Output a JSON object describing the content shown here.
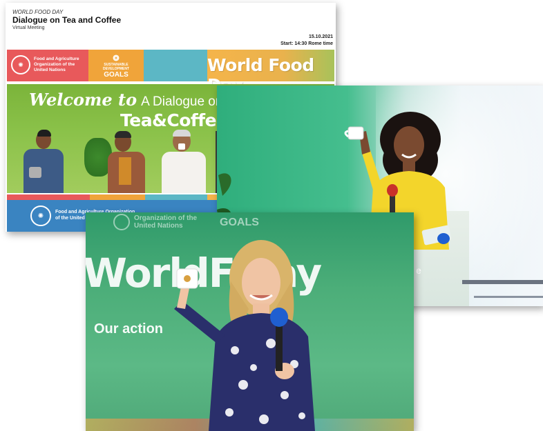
{
  "flyer": {
    "kicker": "WORLD FOOD DAY",
    "title": "Dialogue on Tea and Coffee",
    "subtitle": "Virtual Meeting",
    "date": "15.10.2021",
    "start": "Start: 14:30  Rome time",
    "fao_line1": "Food and Agriculture",
    "fao_line2": "Organization of the",
    "fao_line3": "United Nations",
    "sdg_small": "SUSTAINABLE DEVELOPMENT",
    "sdg_big": "GOALS",
    "banner_title": "World Food Day",
    "welcome_script": "Welcome to",
    "welcome_rest": "A Dialogue on",
    "tea_coffee": "Tea&Coffee",
    "footer_line1": "Food and Agriculture Organization",
    "footer_line2": "of the United"
  },
  "speaker2": {
    "podium_text": "e"
  },
  "speaker1": {
    "logo_line1": "Organization of the",
    "logo_line2": "United Nations",
    "goals": "GOALS",
    "wfd_big": "WorldFo   ay",
    "action": "Our action"
  },
  "colors": {
    "fao_red": "#e8595b",
    "sdg_orange": "#f0a43a",
    "teal": "#5cb7c5",
    "welcome_green": "#8bc24a",
    "footer_blue": "#3a84c1",
    "stage_green": "#4cae79",
    "dress_yellow": "#f3d52b",
    "dress_navy": "#2a2f6b"
  }
}
